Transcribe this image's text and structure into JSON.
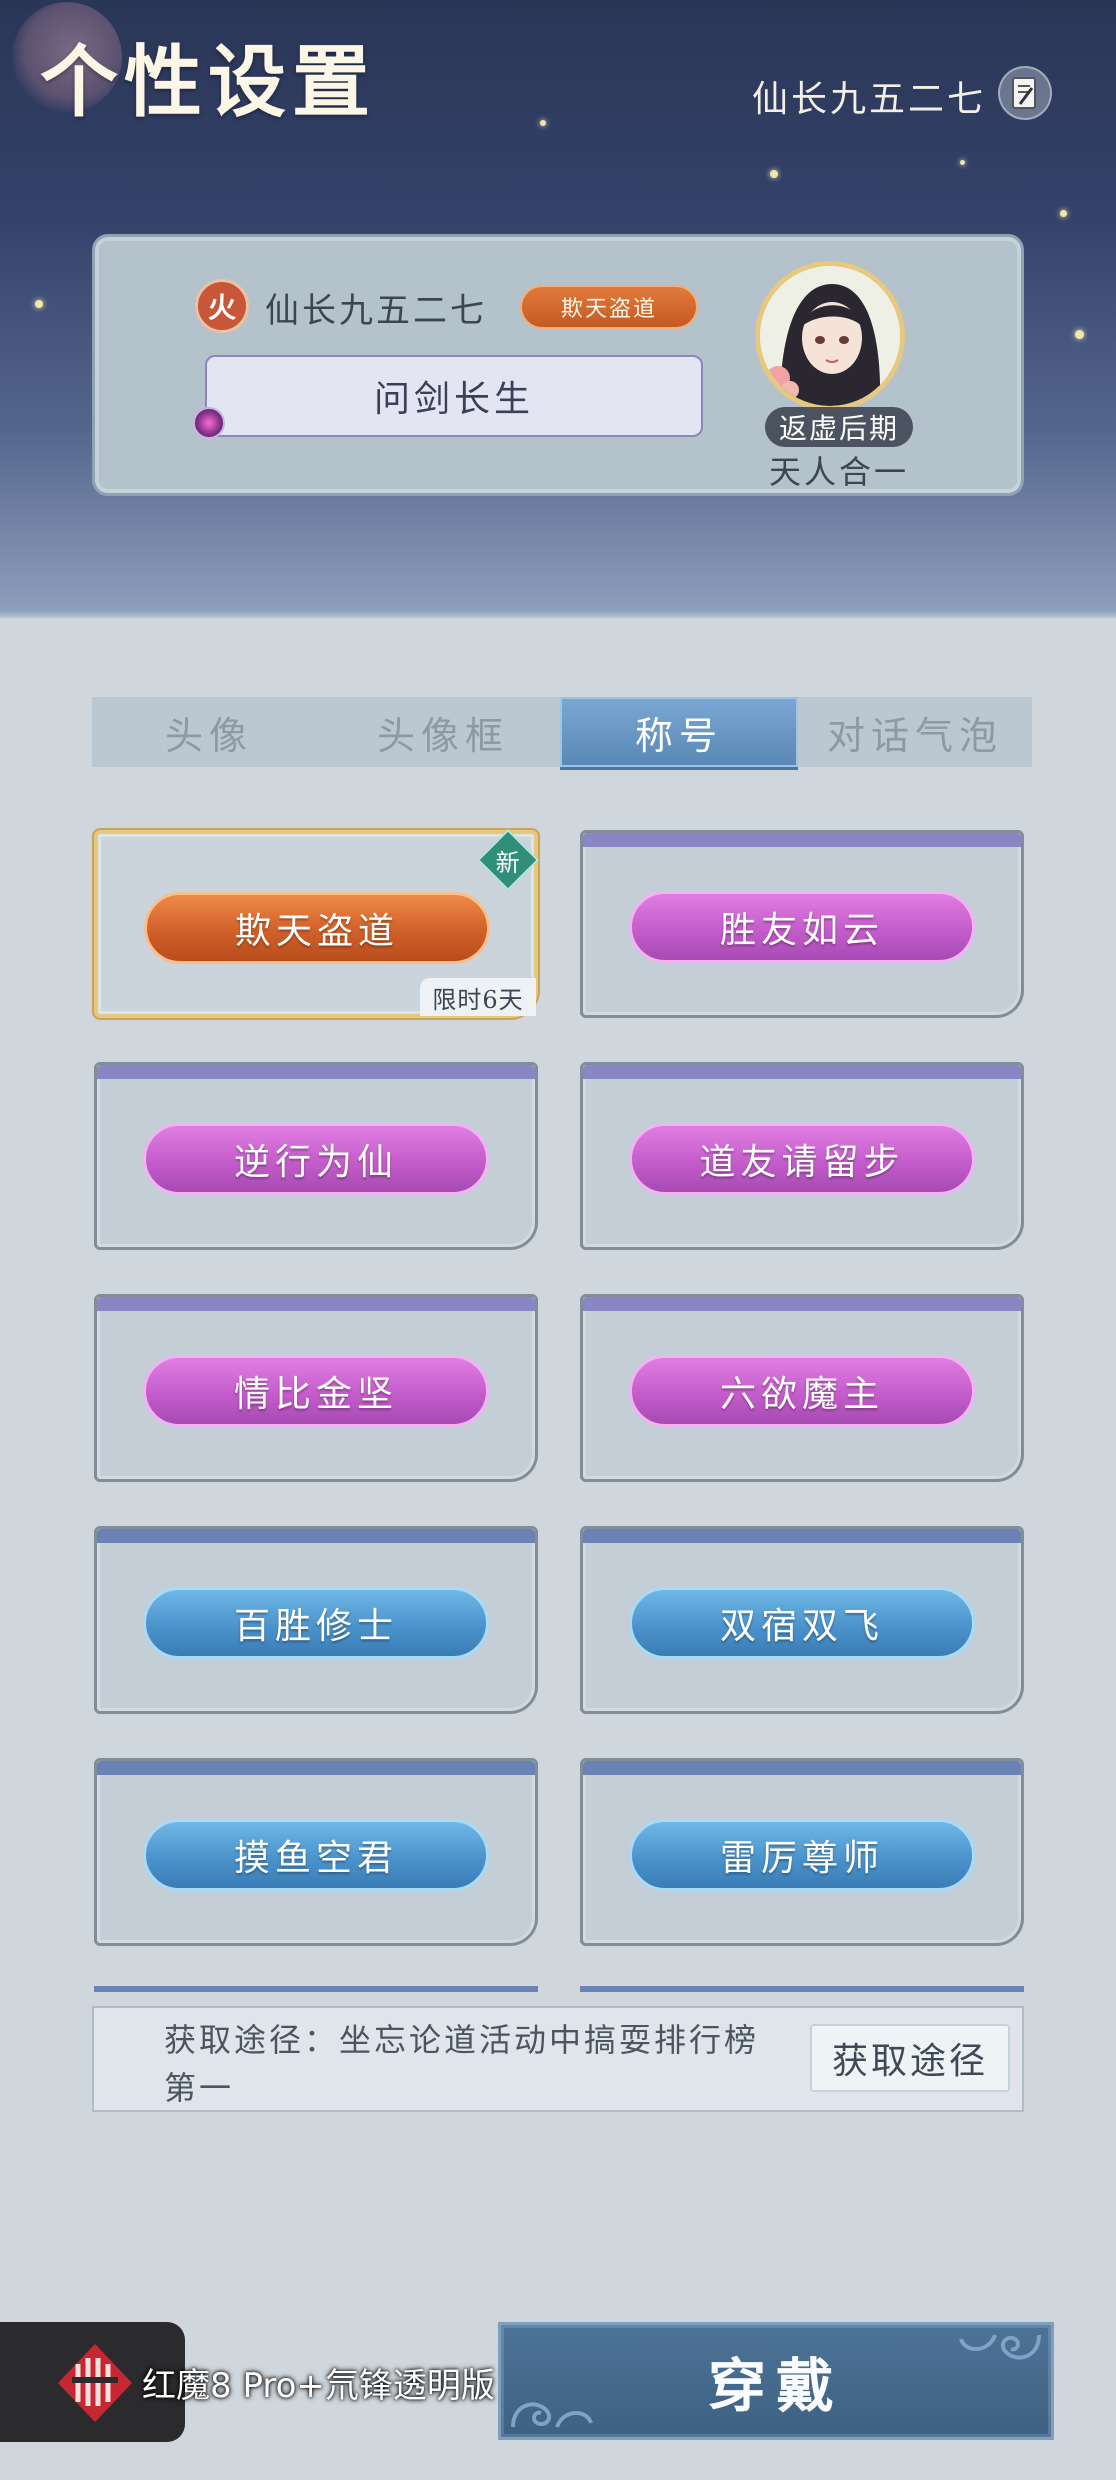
{
  "header": {
    "title": "个性设置",
    "user_name": "仙长九五二七"
  },
  "profile": {
    "element_badge": "火",
    "name": "仙长九五二七",
    "equipped_title": "欺天盗道",
    "bubble_text": "问剑长生",
    "realm": "返虚后期",
    "realm_stage": "天人合一"
  },
  "tabs": [
    {
      "label": "头像",
      "active": false
    },
    {
      "label": "头像框",
      "active": false
    },
    {
      "label": "称号",
      "active": true
    },
    {
      "label": "对话气泡",
      "active": false
    }
  ],
  "titles": [
    {
      "label": "欺天盗道",
      "color": "orange",
      "selected": true,
      "new_badge": "新",
      "limit": "限时6天"
    },
    {
      "label": "胜友如云",
      "color": "purple"
    },
    {
      "label": "逆行为仙",
      "color": "purple"
    },
    {
      "label": "道友请留步",
      "color": "purple"
    },
    {
      "label": "情比金坚",
      "color": "purple"
    },
    {
      "label": "六欲魔主",
      "color": "purple"
    },
    {
      "label": "百胜修士",
      "color": "blue"
    },
    {
      "label": "双宿双飞",
      "color": "blue"
    },
    {
      "label": "摸鱼空君",
      "color": "blue"
    },
    {
      "label": "雷厉尊师",
      "color": "blue"
    }
  ],
  "obtain": {
    "text": "获取途径：坐忘论道活动中搞耍排行榜第一",
    "button_label": "获取途径"
  },
  "bottom": {
    "device_text": "红魔8 Pro+氘锋透明版",
    "wear_label": "穿戴"
  },
  "colors": {
    "pill_orange": "#d1602a",
    "pill_purple": "#c45ccb",
    "pill_blue": "#4b93cc",
    "tab_active": "#5a88b6"
  }
}
